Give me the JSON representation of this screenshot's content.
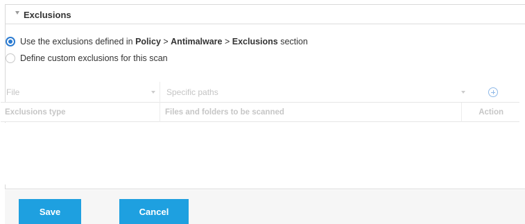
{
  "section": {
    "title": "Exclusions"
  },
  "options": {
    "policy": {
      "selected": true,
      "prefix": "Use the exclusions defined in ",
      "policy": "Policy",
      "sep1": " > ",
      "antimalware": "Antimalware",
      "sep2": " > ",
      "exclusions": "Exclusions",
      "suffix": " section"
    },
    "custom": {
      "selected": false,
      "label": "Define custom exclusions for this scan"
    }
  },
  "filter": {
    "type_value": "File",
    "paths_value": "Specific paths"
  },
  "table": {
    "headers": {
      "type": "Exclusions type",
      "files": "Files and folders to be scanned",
      "action": "Action"
    },
    "rows": []
  },
  "footer": {
    "save_label": "Save",
    "cancel_label": "Cancel"
  },
  "colors": {
    "accent": "#1ea0e0",
    "radio": "#2a7ad0"
  }
}
